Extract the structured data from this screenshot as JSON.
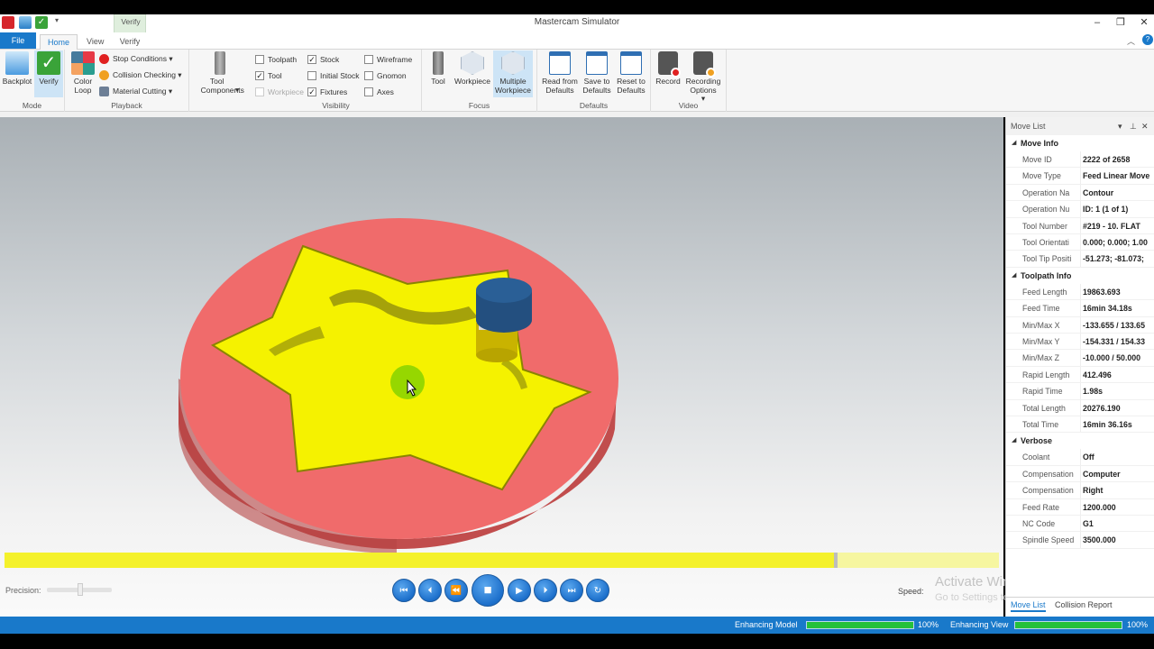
{
  "app": {
    "title": "Mastercam Simulator",
    "context_tab": "Verify"
  },
  "tabs": {
    "file": "File",
    "home": "Home",
    "view": "View",
    "verify": "Verify"
  },
  "ribbon": {
    "mode": {
      "label": "Mode",
      "backplot": "Backplot",
      "verify": "Verify"
    },
    "playback": {
      "label": "Playback",
      "color_loop": "Color Loop",
      "stop_conditions": "Stop Conditions",
      "collision_checking": "Collision Checking",
      "material_cutting": "Material Cutting"
    },
    "tool_components": "Tool Components",
    "visibility": {
      "label": "Visibility",
      "toolpath": "Toolpath",
      "tool": "Tool",
      "workpiece": "Workpiece",
      "stock": "Stock",
      "initial_stock": "Initial Stock",
      "fixtures": "Fixtures",
      "wireframe": "Wireframe",
      "gnomon": "Gnomon",
      "axes": "Axes",
      "checked": {
        "toolpath": false,
        "tool": true,
        "workpiece": false,
        "stock": true,
        "initial_stock": false,
        "fixtures": true,
        "wireframe": false,
        "gnomon": false,
        "axes": false
      }
    },
    "focus": {
      "label": "Focus",
      "tool": "Tool",
      "workpiece": "Workpiece",
      "multiple_workpiece": "Multiple Workpiece"
    },
    "defaults": {
      "label": "Defaults",
      "read": "Read from Defaults",
      "save": "Save to Defaults",
      "reset": "Reset to Defaults"
    },
    "video": {
      "label": "Video",
      "record": "Record",
      "recording_options": "Recording Options"
    }
  },
  "timeline": {
    "progress": 0.836
  },
  "controls": {
    "precision_label": "Precision:",
    "precision_level": 0.5,
    "speed_label": "Speed:"
  },
  "watermark": {
    "line1": "Activate Windows",
    "line2": "Go to Settings to activate Windows."
  },
  "panel": {
    "title": "Move List",
    "sections": [
      {
        "title": "Move Info",
        "rows": [
          {
            "key": "Move ID",
            "value": "2222 of 2658"
          },
          {
            "key": "Move Type",
            "value": "Feed Linear Move"
          },
          {
            "key": "Operation Na",
            "value": "Contour"
          },
          {
            "key": "Operation Nu",
            "value": "ID: 1 (1 of 1)"
          },
          {
            "key": "Tool Number",
            "value": "#219 -    10. FLAT"
          },
          {
            "key": "Tool Orientati",
            "value": "0.000; 0.000; 1.00"
          },
          {
            "key": "Tool Tip Positi",
            "value": "-51.273; -81.073;"
          }
        ]
      },
      {
        "title": "Toolpath Info",
        "rows": [
          {
            "key": "Feed Length",
            "value": "19863.693"
          },
          {
            "key": "Feed Time",
            "value": "16min 34.18s"
          },
          {
            "key": "Min/Max X",
            "value": "-133.655 / 133.65"
          },
          {
            "key": "Min/Max Y",
            "value": "-154.331 / 154.33"
          },
          {
            "key": "Min/Max Z",
            "value": "-10.000 / 50.000"
          },
          {
            "key": "Rapid Length",
            "value": "412.496"
          },
          {
            "key": "Rapid Time",
            "value": "1.98s"
          },
          {
            "key": "Total Length",
            "value": "20276.190"
          },
          {
            "key": "Total Time",
            "value": "16min 36.16s"
          }
        ]
      },
      {
        "title": "Verbose",
        "rows": [
          {
            "key": "Coolant",
            "value": "Off"
          },
          {
            "key": "Compensation",
            "value": "Computer"
          },
          {
            "key": "Compensation",
            "value": "Right"
          },
          {
            "key": "Feed Rate",
            "value": "1200.000"
          },
          {
            "key": "NC Code",
            "value": "G1"
          },
          {
            "key": "Spindle Speed",
            "value": "3500.000"
          }
        ]
      }
    ],
    "tab_move_list": "Move List",
    "tab_collision": "Collision Report"
  },
  "status": {
    "enhancing_model": "Enhancing Model",
    "enhancing_model_pct": "100%",
    "enhancing_model_level": 1.0,
    "enhancing_view": "Enhancing View",
    "enhancing_view_pct": "100%",
    "enhancing_view_level": 1.0
  },
  "colors": {
    "accent": "#1979ca",
    "stock": "#f06b6b",
    "cut_part": "#f5f200",
    "tool_holder": "#2a5f96",
    "progress_green": "#25c13b"
  }
}
